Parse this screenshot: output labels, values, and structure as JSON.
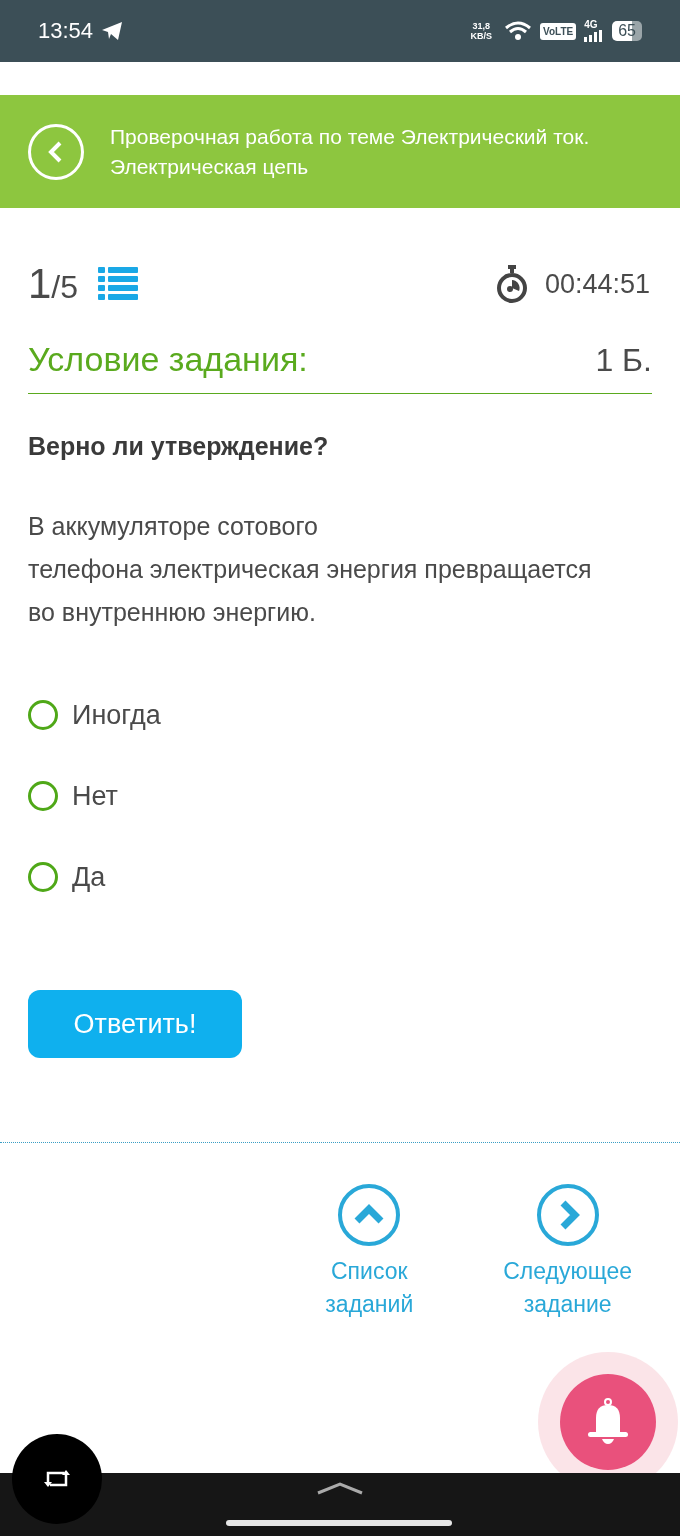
{
  "status_bar": {
    "time": "13:54",
    "speed_value": "31,8",
    "speed_unit": "KB/S",
    "volte": "VoLTE",
    "network": "4G",
    "battery": "65"
  },
  "header": {
    "title": "Проверочная работа по теме Электрический ток. Электрическая цепь"
  },
  "progress": {
    "current": "1",
    "total": "/5",
    "timer": "00:44:51"
  },
  "task": {
    "heading": "Условие задания:",
    "points": "1 Б.",
    "question": "Верно ли утверждение?",
    "statement": "В аккумуляторе сотового\nтелефона электрическая энергия превращается во внутреннюю энергию."
  },
  "options": [
    {
      "label": "Иногда",
      "selected": false
    },
    {
      "label": "Нет",
      "selected": false
    },
    {
      "label": "Да",
      "selected": false
    }
  ],
  "answer_button": "Ответить!",
  "navigation": [
    {
      "kind": "up",
      "label": "Список\nзаданий"
    },
    {
      "kind": "next",
      "label": "Следующее\nзадание"
    }
  ]
}
